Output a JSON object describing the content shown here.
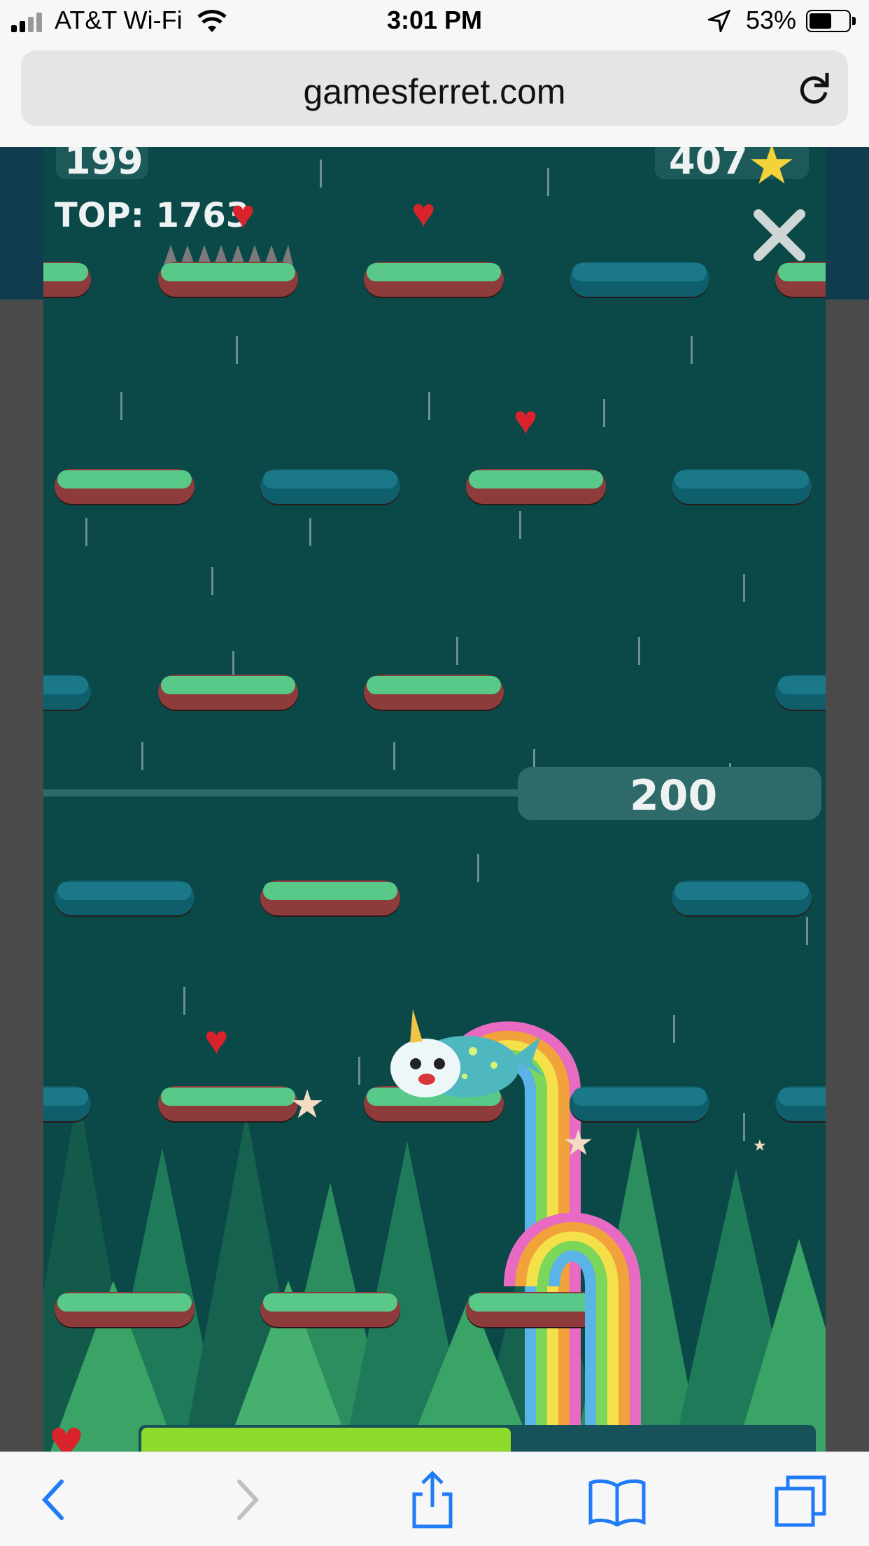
{
  "status_bar": {
    "carrier": "AT&T Wi-Fi",
    "time": "3:01 PM",
    "battery": "53%",
    "icons": [
      "signal-icon",
      "wifi-icon",
      "location-icon",
      "battery-icon"
    ]
  },
  "browser": {
    "url": "gamesferret.com",
    "reload_icon": "reload-icon"
  },
  "game": {
    "score": "199",
    "top_label": "TOP: 1763",
    "stars": "407",
    "milestone": "200",
    "close_icon": "close-icon",
    "colors": {
      "background": "#0b4848",
      "grass": "#59c98a",
      "dirt": "#8e3b3b",
      "teal_platform": "#1a7888"
    },
    "energy_level_percent": 55
  },
  "toolbar": {
    "items": [
      "back-icon",
      "forward-icon",
      "share-icon",
      "bookmarks-icon",
      "tabs-icon"
    ]
  }
}
